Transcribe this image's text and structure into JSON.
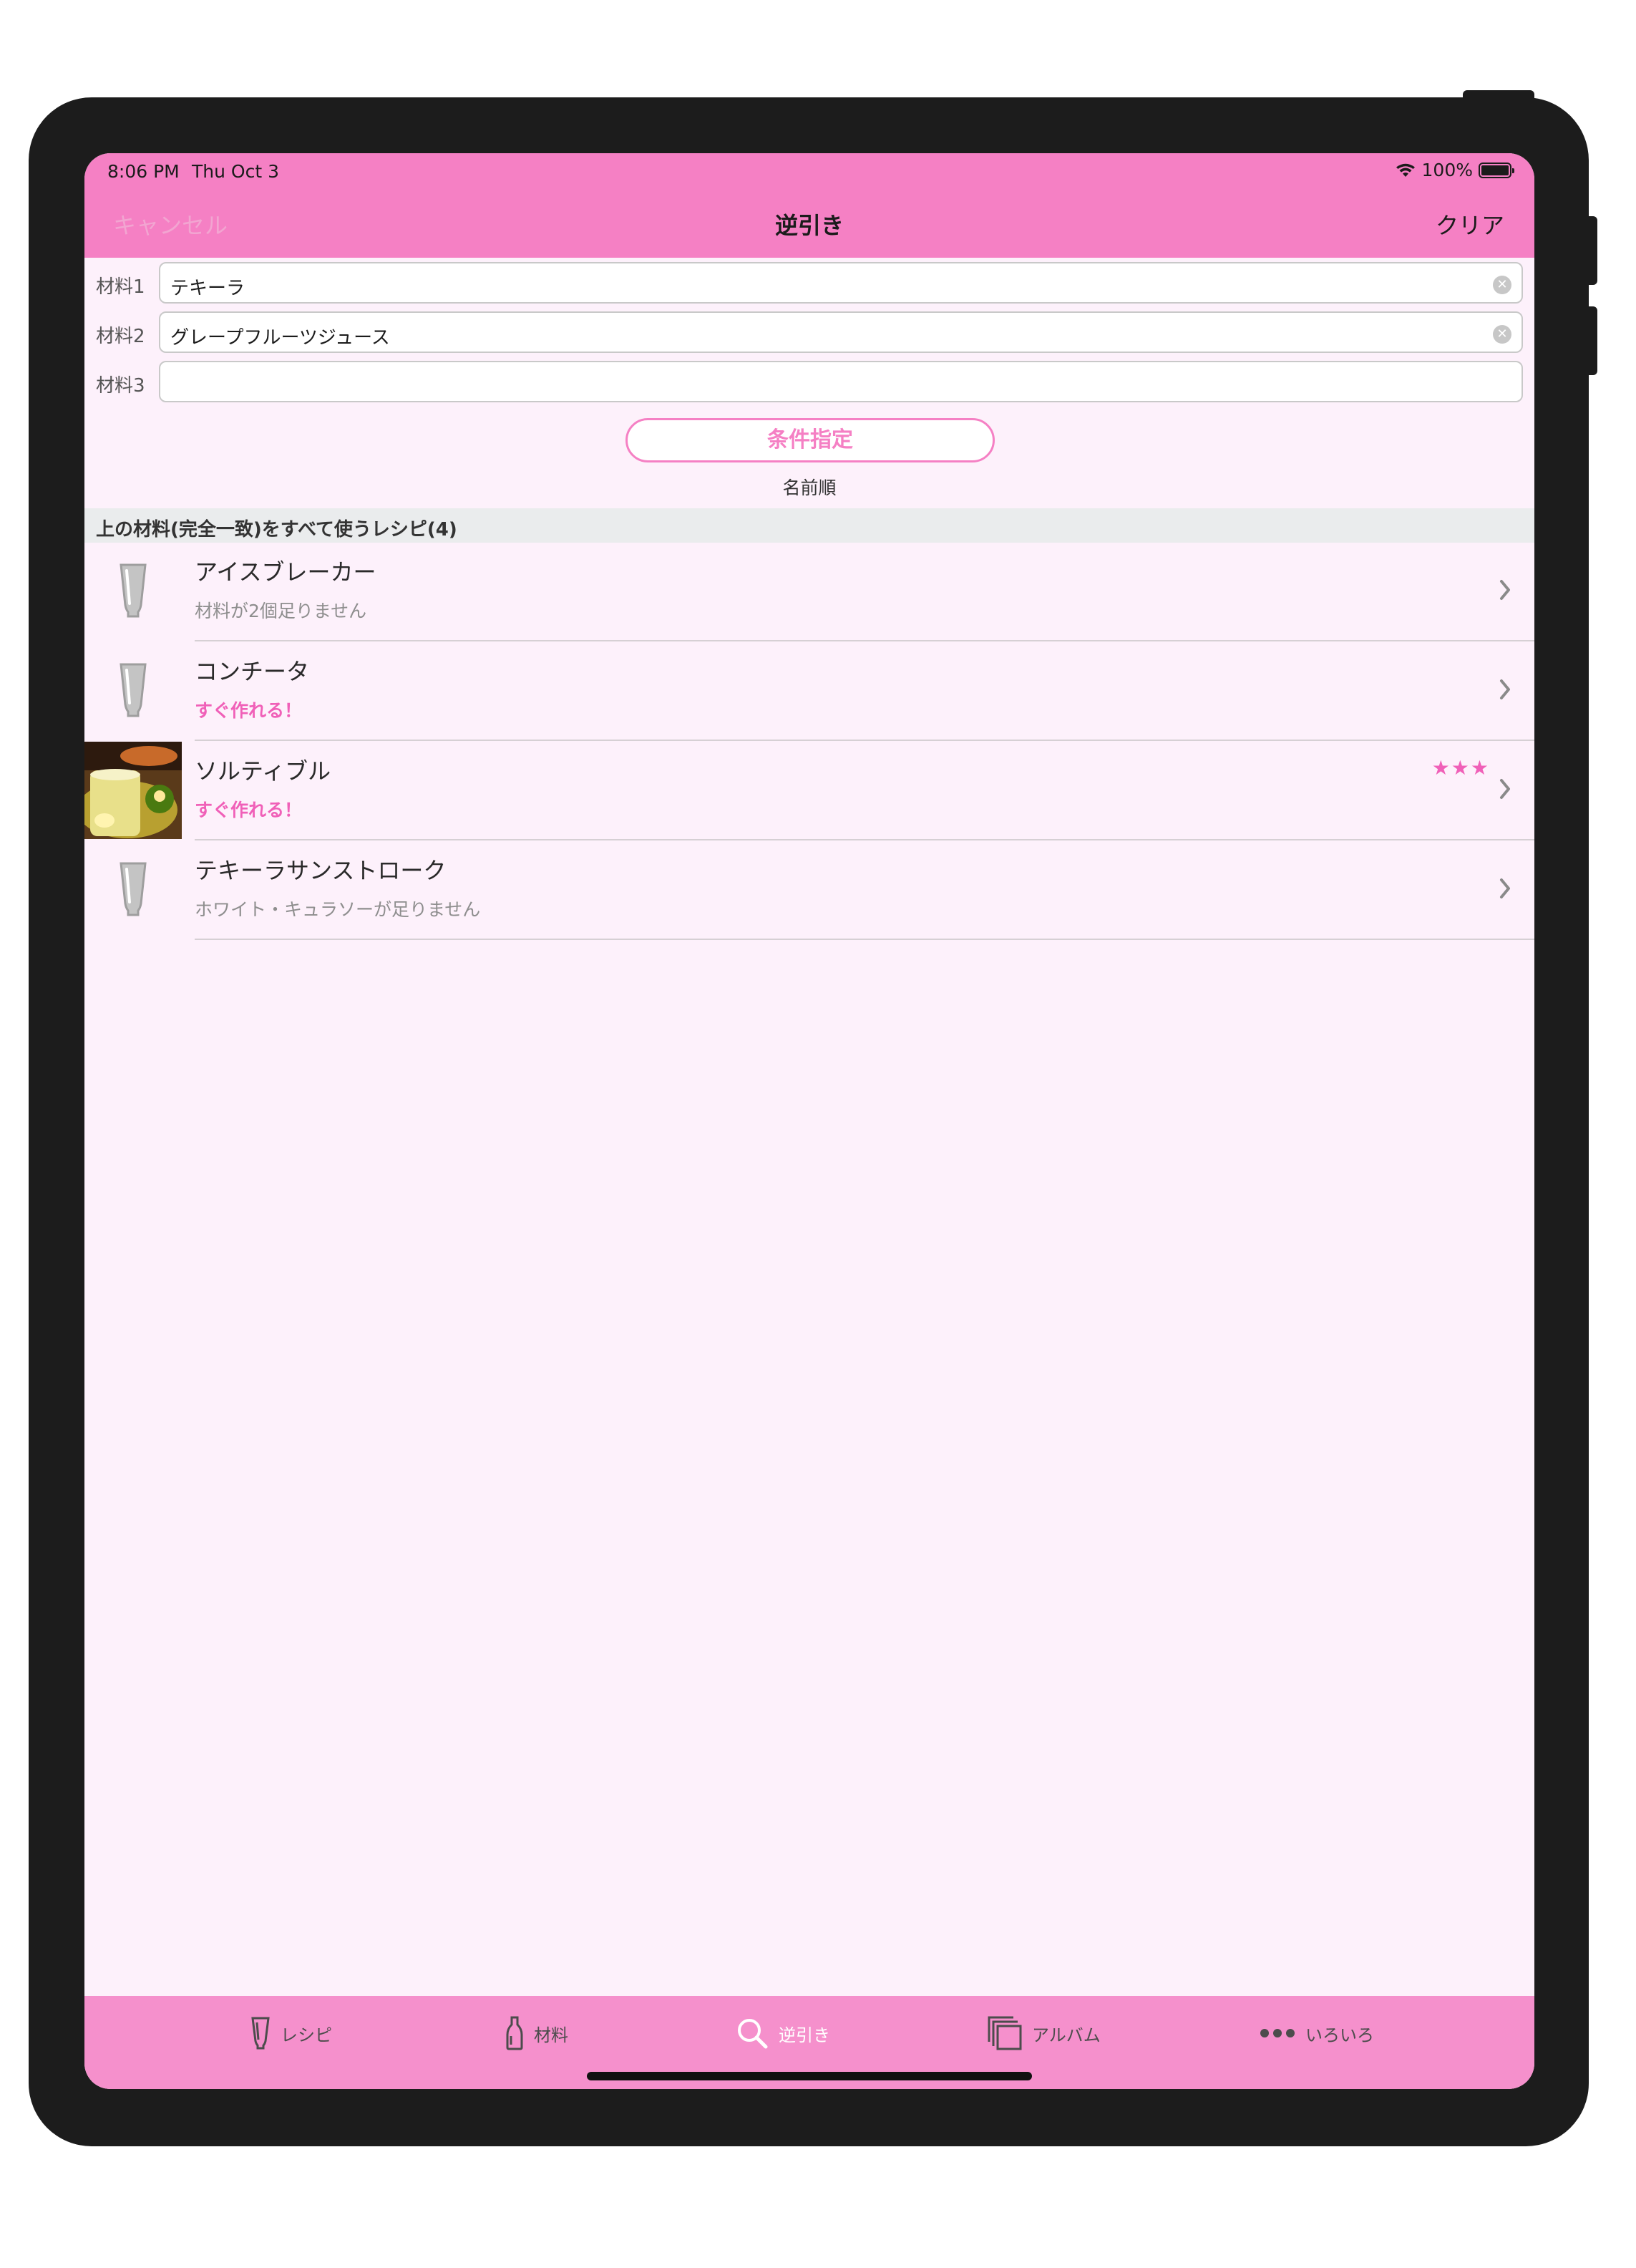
{
  "status_bar": {
    "time": "8:06 PM",
    "date": "Thu Oct 3",
    "battery": "100%",
    "icons": [
      "wifi-icon",
      "battery-icon"
    ]
  },
  "nav": {
    "cancel": "キャンセル",
    "title": "逆引き",
    "clear": "クリア"
  },
  "fields": [
    {
      "label": "材料1",
      "value": "テキーラ",
      "has_clear": true
    },
    {
      "label": "材料2",
      "value": "グレープフルーツジュース",
      "has_clear": true
    },
    {
      "label": "材料3",
      "value": "",
      "has_clear": false
    }
  ],
  "condition_button": "条件指定",
  "sort_label": "名前順",
  "section_header": "上の材料(完全一致)をすべて使うレシピ(4)",
  "recipes": [
    {
      "name": "アイスブレーカー",
      "sub": "材料が2個足りません",
      "makeable": false,
      "stars": "",
      "image": "glass-icon"
    },
    {
      "name": "コンチータ",
      "sub": "すぐ作れる！",
      "makeable": true,
      "stars": "",
      "image": "glass-icon"
    },
    {
      "name": "ソルティブル",
      "sub": "すぐ作れる！",
      "makeable": true,
      "stars": "★★★",
      "image": "cocktail-photo"
    },
    {
      "name": "テキーラサンストローク",
      "sub": "ホワイト・キュラソーが足りません",
      "makeable": false,
      "stars": "",
      "image": "glass-icon"
    }
  ],
  "tabs": [
    {
      "label": "レシピ",
      "icon": "glass-icon",
      "active": false
    },
    {
      "label": "材料",
      "icon": "bottle-icon",
      "active": false
    },
    {
      "label": "逆引き",
      "icon": "search-icon",
      "active": true
    },
    {
      "label": "アルバム",
      "icon": "album-icon",
      "active": false
    },
    {
      "label": "いろいろ",
      "icon": "more-icon",
      "active": false
    }
  ],
  "colors": {
    "accent": "#f580c4",
    "background": "#fdf1fb",
    "tabbar": "#f590cc",
    "section": "#eaeced"
  }
}
